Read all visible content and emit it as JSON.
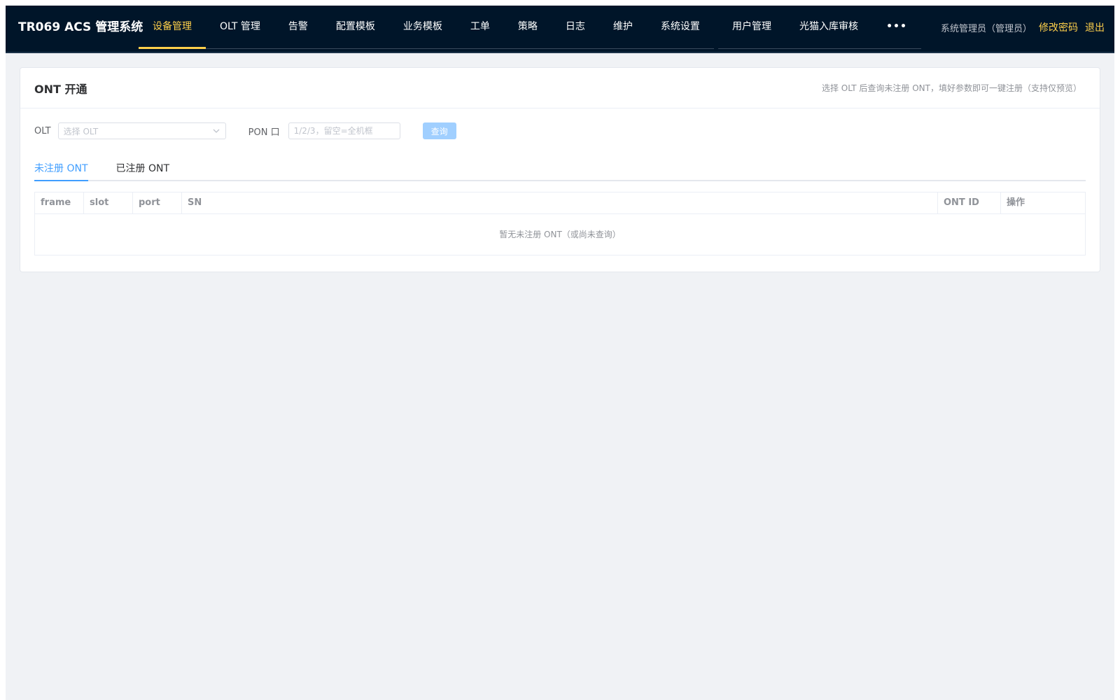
{
  "header": {
    "brand": "TR069 ACS 管理系统",
    "nav": [
      {
        "label": "设备管理",
        "active": true
      },
      {
        "label": "OLT 管理"
      },
      {
        "label": "告警"
      },
      {
        "label": "配置模板"
      },
      {
        "label": "业务模板"
      },
      {
        "label": "工单"
      },
      {
        "label": "策略"
      },
      {
        "label": "日志"
      },
      {
        "label": "维护"
      },
      {
        "label": "系统设置"
      }
    ],
    "nav2": [
      {
        "label": "用户管理"
      },
      {
        "label": "光猫入库审核"
      },
      {
        "label": "•••"
      }
    ],
    "user_label": "系统管理员（管理员）",
    "change_password": "修改密码",
    "logout": "退出",
    "accent_color": "#ffd04b",
    "background_color": "#001529"
  },
  "card": {
    "title": "ONT 开通",
    "hint": "选择 OLT 后查询未注册 ONT，填好参数即可一键注册（支持仅预览）"
  },
  "form": {
    "olt_label": "OLT",
    "olt_placeholder": "选择 OLT",
    "pon_label": "PON 口",
    "pon_placeholder": "1/2/3，留空=全机框",
    "query_button": "查询"
  },
  "tabs": [
    {
      "label": "未注册 ONT",
      "active": true
    },
    {
      "label": "已注册 ONT"
    }
  ],
  "table": {
    "columns": [
      "frame",
      "slot",
      "port",
      "SN",
      "ONT ID",
      "操作"
    ],
    "empty_text": "暂无未注册 ONT（或尚未查询）"
  },
  "colors": {
    "primary": "#409eff",
    "primary_disabled": "#a0cfff",
    "page_background": "#f0f2f5"
  },
  "icons": {
    "select_arrow": "chevron-down-icon",
    "more": "more-dots-icon"
  }
}
